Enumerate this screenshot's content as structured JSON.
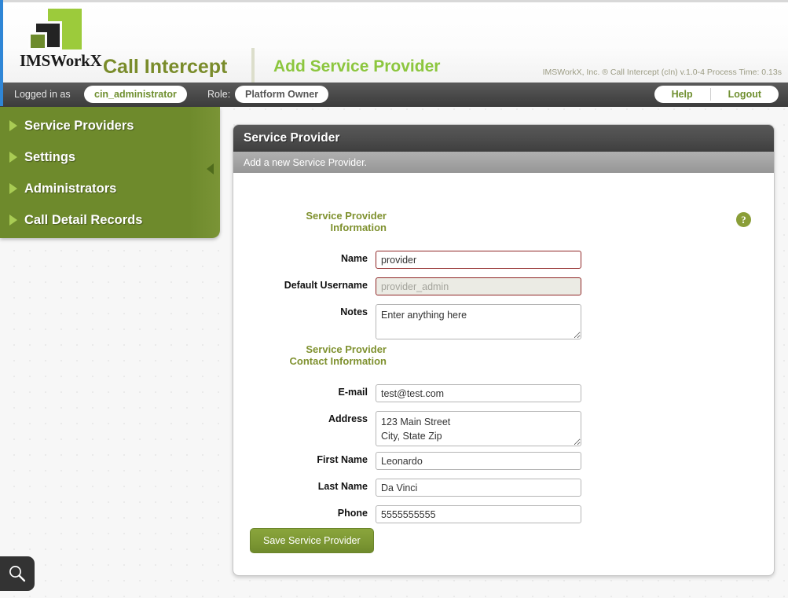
{
  "header": {
    "logo_text": "IMSWorkX",
    "app_title": "Call Intercept",
    "page_title": "Add Service Provider",
    "version_line": "IMSWorkX, Inc. ® Call Intercept (cIn) v.1.0-4  Process Time: 0.13s"
  },
  "userbar": {
    "logged_in_label": "Logged in as",
    "username": "cin_administrator",
    "role_label": "Role:",
    "role": "Platform Owner",
    "help_label": "Help",
    "logout_label": "Logout"
  },
  "sidebar": {
    "items": [
      {
        "label": "Service Providers"
      },
      {
        "label": "Settings"
      },
      {
        "label": "Administrators"
      },
      {
        "label": "Call Detail Records"
      }
    ]
  },
  "panel": {
    "title": "Service Provider",
    "subtitle": "Add a new Service Provider.",
    "help_glyph": "?"
  },
  "form": {
    "section_info": "Service Provider\nInformation",
    "section_info_line1": "Service Provider",
    "section_info_line2": "Information",
    "section_contact_line1": "Service Provider",
    "section_contact_line2": "Contact Information",
    "fields": {
      "name": {
        "label": "Name",
        "value": "provider",
        "placeholder": ""
      },
      "default_username": {
        "label": "Default Username",
        "value": "provider_admin",
        "placeholder": "provider_admin"
      },
      "notes": {
        "label": "Notes",
        "value": "Enter anything here",
        "placeholder": "Enter anything here"
      },
      "email": {
        "label": "E-mail",
        "value": "test@test.com",
        "placeholder": ""
      },
      "address": {
        "label": "Address",
        "value": "123 Main Street\nCity, State Zip",
        "placeholder": ""
      },
      "first_name": {
        "label": "First Name",
        "value": "Leonardo",
        "placeholder": ""
      },
      "last_name": {
        "label": "Last Name",
        "value": "Da Vinci",
        "placeholder": ""
      },
      "phone": {
        "label": "Phone",
        "value": "5555555555",
        "placeholder": ""
      }
    },
    "save_label": "Save Service Provider"
  },
  "colors": {
    "brand_green": "#8cc63e",
    "olive": "#6e8a2c",
    "app_title_green": "#7a8c2b",
    "required_border": "#8f2626",
    "dark_bar": "#4a4a4a"
  },
  "fab": {
    "icon": "search-icon"
  }
}
